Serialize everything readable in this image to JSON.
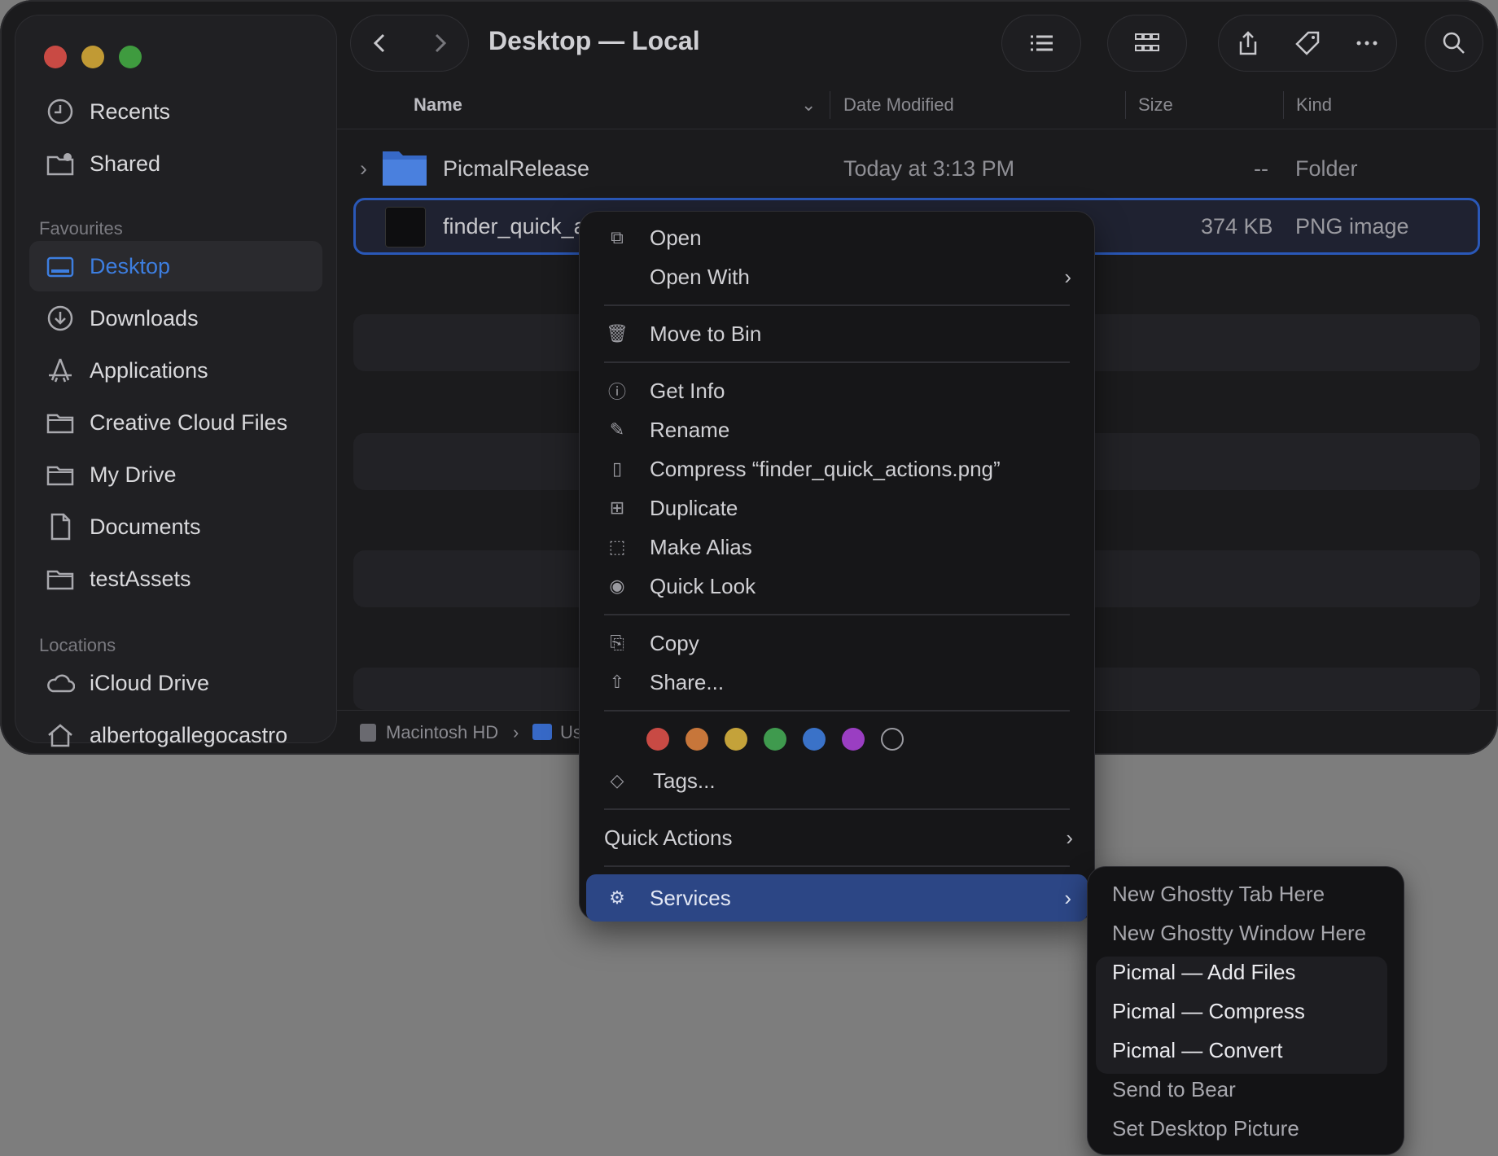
{
  "window": {
    "title": "Desktop — Local"
  },
  "sidebar": {
    "top_items": [
      {
        "label": "Recents",
        "icon": "clock-icon"
      },
      {
        "label": "Shared",
        "icon": "shared-folder-icon"
      }
    ],
    "favourites_heading": "Favourites",
    "favourites": [
      {
        "label": "Desktop",
        "icon": "desktop-icon",
        "active": true
      },
      {
        "label": "Downloads",
        "icon": "download-icon"
      },
      {
        "label": "Applications",
        "icon": "applications-icon"
      },
      {
        "label": "Creative Cloud Files",
        "icon": "folder-icon"
      },
      {
        "label": "My Drive",
        "icon": "folder-icon"
      },
      {
        "label": "Documents",
        "icon": "document-icon"
      },
      {
        "label": "testAssets",
        "icon": "folder-icon"
      }
    ],
    "locations_heading": "Locations",
    "locations": [
      {
        "label": "iCloud Drive",
        "icon": "cloud-icon"
      },
      {
        "label": "albertogallegocastro",
        "icon": "home-icon"
      }
    ]
  },
  "columns": {
    "name": "Name",
    "date_modified": "Date Modified",
    "size": "Size",
    "kind": "Kind"
  },
  "files": [
    {
      "name": "PicmalRelease",
      "date": "Today at 3:13 PM",
      "size": "--",
      "kind": "Folder"
    },
    {
      "name": "finder_quick_a",
      "date": "",
      "size": "374 KB",
      "kind": "PNG image"
    }
  ],
  "pathbar": {
    "disk": "Macintosh HD",
    "sep": "›",
    "next": "Us"
  },
  "context_menu": {
    "open": "Open",
    "open_with": "Open With",
    "move_to_bin": "Move to Bin",
    "get_info": "Get Info",
    "rename": "Rename",
    "compress": "Compress “finder_quick_actions.png”",
    "duplicate": "Duplicate",
    "make_alias": "Make Alias",
    "quick_look": "Quick Look",
    "copy": "Copy",
    "share": "Share...",
    "tags": "Tags...",
    "quick_actions": "Quick Actions",
    "services": "Services",
    "tag_colors": [
      "#c84a44",
      "#c7763a",
      "#c4a23a",
      "#3f9a4e",
      "#3a72c8",
      "#9a3ec2"
    ]
  },
  "services_submenu": [
    {
      "label": "New Ghostty Tab Here",
      "bright": false
    },
    {
      "label": "New Ghostty Window Here",
      "bright": false
    },
    {
      "label": "Picmal — Add Files",
      "bright": true
    },
    {
      "label": "Picmal — Compress",
      "bright": true
    },
    {
      "label": "Picmal — Convert",
      "bright": true
    },
    {
      "label": "Send to Bear",
      "bright": false
    },
    {
      "label": "Set Desktop Picture",
      "bright": false
    }
  ]
}
